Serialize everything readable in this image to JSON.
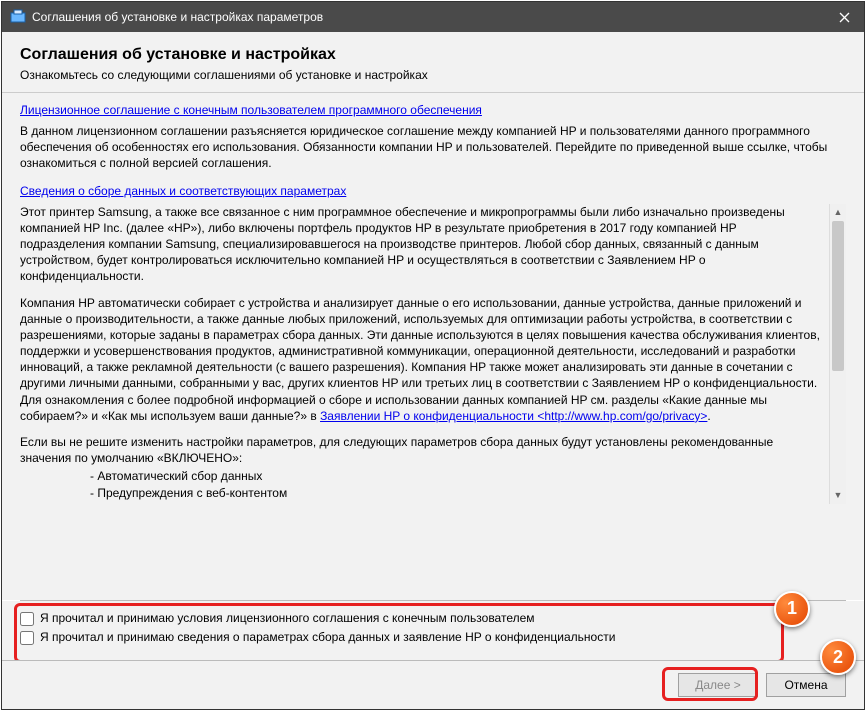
{
  "window": {
    "title": "Соглашения об установке и настройках параметров"
  },
  "header": {
    "title": "Соглашения об установке и настройках",
    "subtitle": "Ознакомьтесь со следующими соглашениями об установке и настройках"
  },
  "links": {
    "eula": "Лицензионное соглашение с конечным пользователем программного обеспечения",
    "data_info": "Сведения о сборе данных и соответствующих параметрах",
    "privacy": "Заявлении HP о конфиденциальности <http://www.hp.com/go/privacy>"
  },
  "paras": {
    "p1": "В данном лицензионном соглашении разъясняется юридическое соглашение между компанией HP и пользователями данного программного обеспечения об особенностях его использования. Обязанности компании HP и пользователей. Перейдите по приведенной выше ссылке, чтобы ознакомиться с полной версией соглашения.",
    "p2": "Этот принтер Samsung, а также все связанное с ним программное обеспечение и микропрограммы были либо изначально произведены компанией HP Inc. (далее «HP»), либо включены портфель продуктов HP в результате приобретения в 2017 году компанией HP подразделения компании Samsung, специализировавшегося на производстве принтеров.  Любой сбор данных, связанный с данным устройством, будет контролироваться исключительно компанией HP и осуществляться в соответствии с Заявлением HP о конфиденциальности.",
    "p3_a": "Компания HP автоматически собирает с устройства и анализирует данные о его использовании, данные устройства, данные приложений и данные о производительности, а также данные любых приложений, используемых для оптимизации работы устройства, в соответствии с разрешениями, которые заданы в параметрах сбора данных. Эти данные используются в целях повышения качества обслуживания клиентов, поддержки и усовершенствования продуктов, административной коммуникации, операционной деятельности, исследований и разработки инноваций, а также рекламной деятельности (с вашего разрешения). Компания HP также может анализировать эти данные в сочетании с другими личными данными, собранными у вас, других клиентов HP или третьих лиц в соответствии с Заявлением HP о конфиденциальности. Для ознакомления с более подробной информацией о сборе и использовании данных компанией HP см. разделы «Какие данные мы собираем?» и «Как мы используем ваши данные?» в ",
    "p3_b": ".",
    "p4": "Если вы не решите изменить настройки параметров, для следующих параметров сбора данных будут установлены рекомендованные значения по умолчанию «ВКЛЮЧЕНО»:",
    "bullets": {
      "b1": "- Автоматический сбор данных",
      "b2": "- Предупреждения с веб-контентом"
    }
  },
  "checks": {
    "c1": "Я прочитал и принимаю условия лицензионного соглашения с конечным пользователем",
    "c2": "Я прочитал и принимаю сведения о параметрах сбора данных и заявление HP о конфиденциальности"
  },
  "buttons": {
    "next": "Далее >",
    "cancel": "Отмена"
  },
  "callouts": {
    "one": "1",
    "two": "2"
  }
}
